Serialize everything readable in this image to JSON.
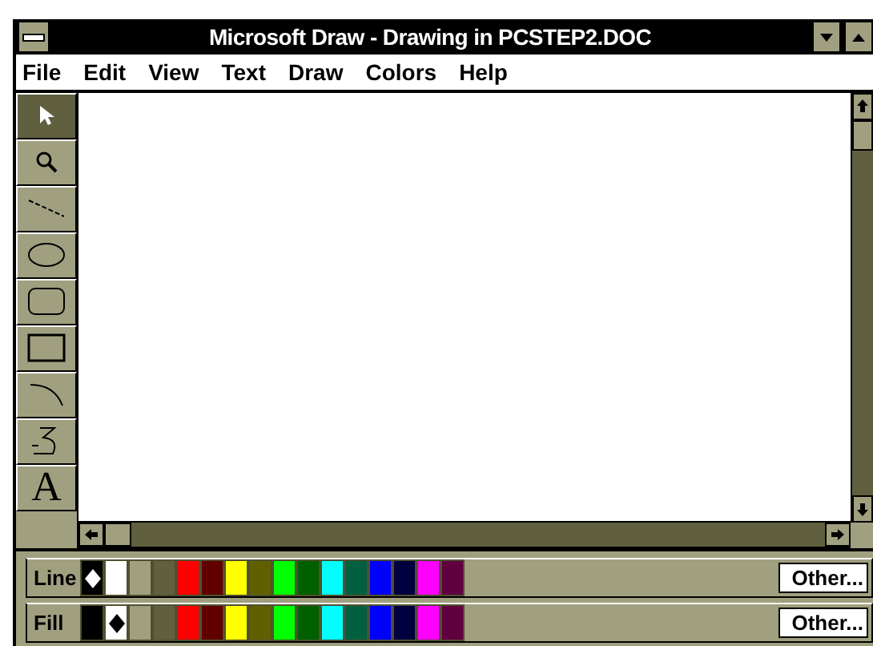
{
  "window": {
    "title": "Microsoft Draw - Drawing in PCSTEP2.DOC"
  },
  "menu": [
    "File",
    "Edit",
    "View",
    "Text",
    "Draw",
    "Colors",
    "Help"
  ],
  "tools": [
    {
      "kind": "pointer",
      "selected": true
    },
    {
      "kind": "zoom",
      "selected": false
    },
    {
      "kind": "line",
      "selected": false
    },
    {
      "kind": "ellipse",
      "selected": false
    },
    {
      "kind": "rounded-rect",
      "selected": false
    },
    {
      "kind": "rect",
      "selected": false
    },
    {
      "kind": "arc",
      "selected": false
    },
    {
      "kind": "freeform",
      "selected": false
    },
    {
      "kind": "text",
      "label": "A",
      "selected": false
    }
  ],
  "palettes": [
    {
      "label": "Line",
      "button": "Other...",
      "swatches": [
        {
          "color": "#000000",
          "selected": true
        },
        {
          "color": "#ffffff",
          "selected": false
        },
        {
          "color": "#a0a080",
          "selected": false
        },
        {
          "color": "#606040",
          "selected": false
        },
        {
          "color": "#ff0000",
          "selected": false
        },
        {
          "color": "#600000",
          "selected": false
        },
        {
          "color": "#ffff00",
          "selected": false
        },
        {
          "color": "#606000",
          "selected": false
        },
        {
          "color": "#00ff00",
          "selected": false
        },
        {
          "color": "#006000",
          "selected": false
        },
        {
          "color": "#00ffff",
          "selected": false
        },
        {
          "color": "#006040",
          "selected": false
        },
        {
          "color": "#0000ff",
          "selected": false
        },
        {
          "color": "#000040",
          "selected": false
        },
        {
          "color": "#ff00ff",
          "selected": false
        },
        {
          "color": "#600040",
          "selected": false
        }
      ]
    },
    {
      "label": "Fill",
      "button": "Other...",
      "swatches": [
        {
          "color": "#000000",
          "selected": false
        },
        {
          "color": "#ffffff",
          "selected": true
        },
        {
          "color": "#a0a080",
          "selected": false
        },
        {
          "color": "#606040",
          "selected": false
        },
        {
          "color": "#ff0000",
          "selected": false
        },
        {
          "color": "#600000",
          "selected": false
        },
        {
          "color": "#ffff00",
          "selected": false
        },
        {
          "color": "#606000",
          "selected": false
        },
        {
          "color": "#00ff00",
          "selected": false
        },
        {
          "color": "#006000",
          "selected": false
        },
        {
          "color": "#00ffff",
          "selected": false
        },
        {
          "color": "#006040",
          "selected": false
        },
        {
          "color": "#0000ff",
          "selected": false
        },
        {
          "color": "#000040",
          "selected": false
        },
        {
          "color": "#ff00ff",
          "selected": false
        },
        {
          "color": "#600040",
          "selected": false
        }
      ]
    }
  ]
}
